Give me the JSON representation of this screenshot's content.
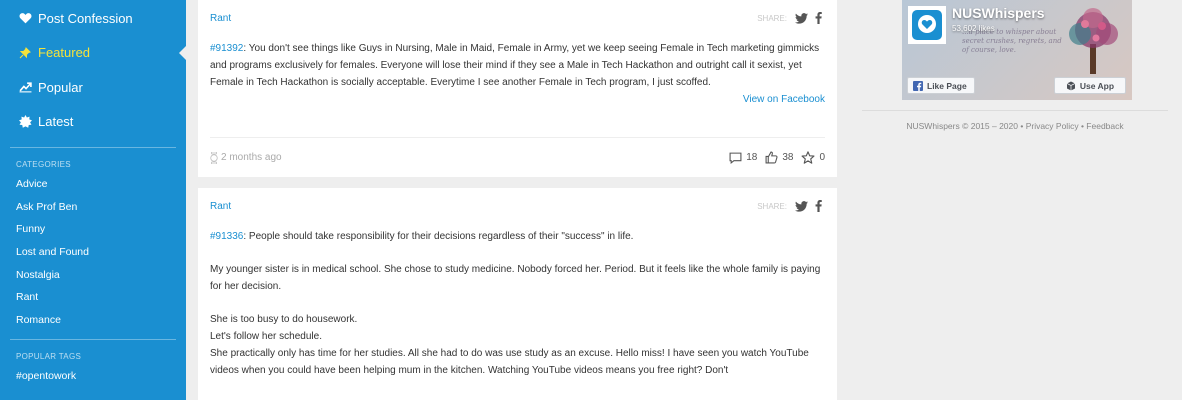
{
  "sidebar": {
    "nav": [
      {
        "label": "Post Confession",
        "icon": "heart-icon"
      },
      {
        "label": "Featured",
        "icon": "pin-icon"
      },
      {
        "label": "Popular",
        "icon": "trend-icon"
      },
      {
        "label": "Latest",
        "icon": "burst-icon"
      }
    ],
    "categories_title": "CATEGORIES",
    "categories": [
      "Advice",
      "Ask Prof Ben",
      "Funny",
      "Lost and Found",
      "Nostalgia",
      "Rant",
      "Romance"
    ],
    "tags_title": "POPULAR TAGS",
    "tags": [
      "#opentowork"
    ],
    "colors": {
      "background": "#1a8fd1",
      "active": "#f5e33a"
    }
  },
  "posts": [
    {
      "category": "Rant",
      "share_label": "SHARE:",
      "id": "#91392",
      "text": ":  You don't see things like Guys in Nursing, Male in Maid, Female in Army, yet we keep seeing Female in Tech marketing gimmicks and programs exclusively for females. Everyone will lose their mind if they see a Male in Tech Hackathon and outright call it sexist, yet Female in Tech Hackathon is socially acceptable. Everytime I see another Female in Tech program, I just scoffed.",
      "view_link": "View on Facebook",
      "time": "2 months ago",
      "comments": "18",
      "likes": "38",
      "stars": "0"
    },
    {
      "category": "Rant",
      "share_label": "SHARE:",
      "id": "#91336",
      "paragraphs": [
        ":  People should take responsibility for their decisions regardless of their \"success\" in life.",
        "My younger sister is in medical school. She chose to study medicine. Nobody forced her. Period. But it feels like the whole family is paying for her decision.",
        "She is too busy to do housework.",
        "Let's follow her schedule.",
        "She practically only has time for her studies. All she had to do was use study as an excuse. Hello miss! I have seen you watch YouTube videos when you could have been helping mum in the kitchen. Watching YouTube videos means you free right? Don't"
      ]
    }
  ],
  "fb_widget": {
    "title": "NUSWhispers",
    "likes": "53,602 likes",
    "like_button": "Like Page",
    "app_button": "Use App",
    "script_text": "...a place to whisper about secret crushes, regrets, and of course, love."
  },
  "footer": {
    "copyright": "NUSWhispers © 2015 – 2020",
    "sep": " • ",
    "privacy": "Privacy Policy",
    "feedback": "Feedback"
  }
}
